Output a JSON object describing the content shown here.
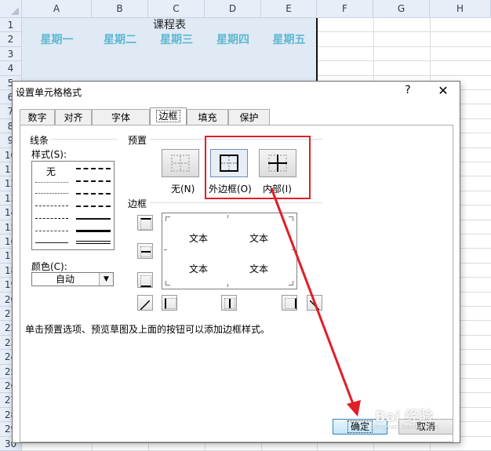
{
  "sheet": {
    "columns": [
      "A",
      "B",
      "C",
      "D",
      "E",
      "F",
      "G",
      "H"
    ],
    "rows": [
      "1",
      "2",
      "3",
      "4",
      "5",
      "6",
      "7",
      "8",
      "9",
      "10",
      "11",
      "12",
      "13",
      "14",
      "15",
      "16",
      "17",
      "18",
      "19",
      "20",
      "21",
      "22",
      "23",
      "24",
      "25",
      "26",
      "27",
      "28",
      "29",
      "30"
    ],
    "title": "课程表",
    "days": [
      "星期一",
      "星期二",
      "星期三",
      "星期四",
      "星期五"
    ],
    "day_color": "#60b7d1"
  },
  "dialog": {
    "title": "设置单元格格式",
    "help": "?",
    "close": "✕",
    "tabs": [
      "数字",
      "对齐",
      "字体",
      "边框",
      "填充",
      "保护"
    ],
    "active_tab": "边框",
    "line_group": "线条",
    "style_label": "样式(S):",
    "style_none": "无",
    "color_label": "颜色(C):",
    "color_value": "自动",
    "preset_group": "预置",
    "presets": [
      "无(N)",
      "外边框(O)",
      "内部(I)"
    ],
    "border_group": "边框",
    "preview_text": "文本",
    "hint": "单击预置选项、预览草图及上面的按钮可以添加边框样式。",
    "ok": "确定",
    "cancel": "取消"
  },
  "annotation": {
    "color": "#e11d25"
  },
  "watermark": {
    "text": "Bai 经验",
    "sub": "jingyan.baidu.com"
  }
}
